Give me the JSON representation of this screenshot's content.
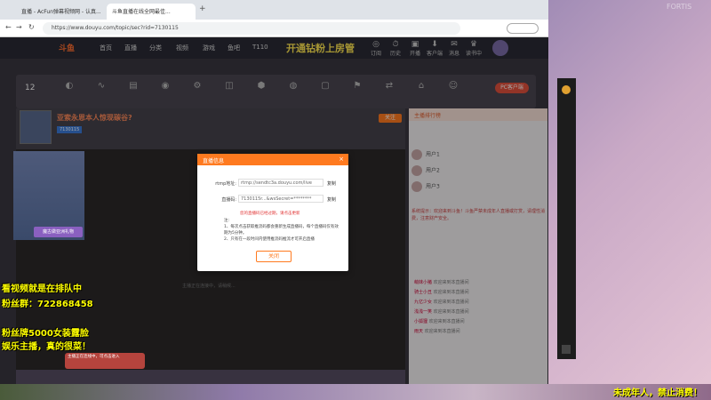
{
  "browser": {
    "tabs": [
      {
        "label": "直播 - AcFun弹幕视频网 - 认真..."
      },
      {
        "label": "斗鱼直播在线全网最佳..."
      }
    ],
    "url": "https://www.douyu.com/topic/sec?rid=7130115",
    "address_icons": [
      "←",
      "→",
      "↻"
    ]
  },
  "douyu_nav": {
    "logo": "斗鱼",
    "items": [
      "首页",
      "直播",
      "分类",
      "视频",
      "游戏",
      "鱼吧",
      "T110"
    ],
    "promo": "开通钻粉上房管",
    "header_icons": [
      {
        "glyph": "◎",
        "label": "订阅"
      },
      {
        "glyph": "⏱",
        "label": "历史"
      },
      {
        "glyph": "▣",
        "label": "开播"
      },
      {
        "glyph": "⬇",
        "label": "客户端"
      },
      {
        "glyph": "✉",
        "label": "消息"
      },
      {
        "glyph": "♛",
        "label": "读书中心"
      }
    ]
  },
  "toolbar": {
    "level": "12",
    "items": [
      "",
      "",
      "",
      "",
      "",
      "",
      "",
      "",
      "",
      "",
      "",
      "",
      "",
      "",
      ""
    ],
    "pc_button": "PC客户端"
  },
  "room": {
    "title": "亚索永恩本人惊现碳谷?",
    "tag": "7130115",
    "follow": "关注"
  },
  "chat": {
    "tab_label": "主播排行榜",
    "rank": [
      "用户1",
      "用户2",
      "用户3"
    ],
    "system_message": "系统提示：欢迎来到斗鱼！斗鱼严禁未成年人直播或打赏，请理性消费，注意财产安全。",
    "welcome": [
      {
        "name": "萌妹小猪",
        "text": "欢迎来到本直播间"
      },
      {
        "name": "骑士小丑",
        "text": "欢迎来到本直播间"
      },
      {
        "name": "九亿少女",
        "text": "欢迎来到本直播间"
      },
      {
        "name": "浅浅一笑",
        "text": "欢迎来到本直播间"
      },
      {
        "name": "小狐狸",
        "text": "欢迎来到本直播间"
      },
      {
        "name": "雨天",
        "text": "欢迎来到本直播间"
      }
    ]
  },
  "modal": {
    "title": "直播信息",
    "close": "×",
    "rtmp_label": "rtmp地址:",
    "rtmp_value": "rtmp://sendtc3a.douyu.com/live",
    "key_label": "直播码:",
    "key_value": "7130115r...&wsSecret=********",
    "copy": "复制",
    "warning": "您的直播码已经过期，请点击更新",
    "notes": "注:\n1、每次点击获取推流码都会重新生成直播码，每个直播码仅有效期为5分钟。\n2、只有在一段时间内使用推流码推流才可开启直播",
    "button": "关闭"
  },
  "player": {
    "hint": "主播正在连接中，请稍候..."
  },
  "overlay": {
    "line1": "看视频就是在排队中",
    "line2": "粉丝群：722868458",
    "line3": "粉丝牌5000女装露脸",
    "line4": "娱乐主播，真的很菜！",
    "bottom_right": "未成年人，禁止消费！",
    "watermark": "FORTIS"
  },
  "gift": {
    "text": "主播正在连线中，可点击进入"
  },
  "catlogo": {
    "banner": "魔古做亚洲礼物"
  }
}
